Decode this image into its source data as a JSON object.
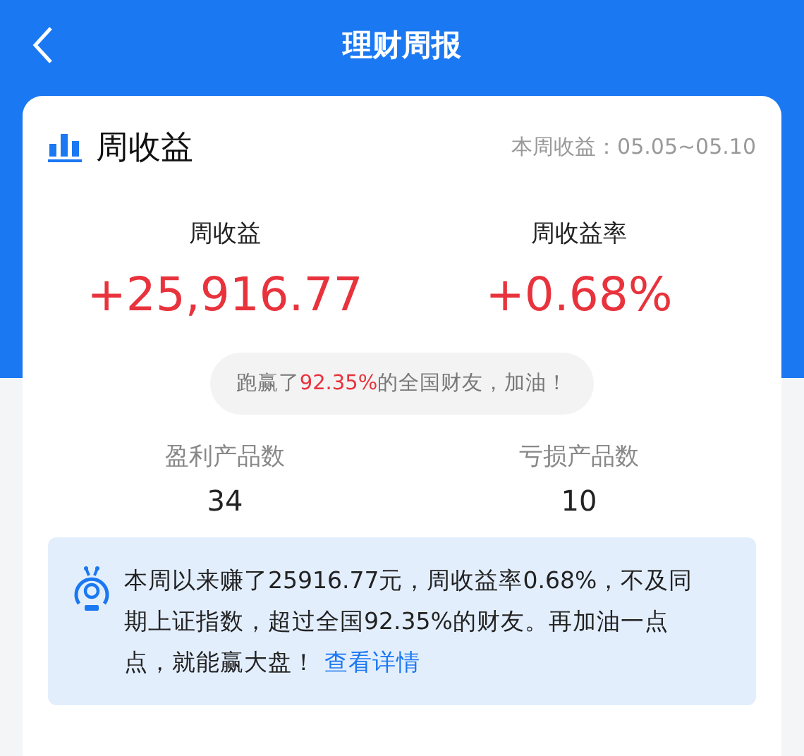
{
  "nav": {
    "title": "理财周报"
  },
  "card": {
    "title": "周收益",
    "period_label": "本周收益：",
    "period": "05.05~05.10",
    "stats": [
      {
        "label": "周收益",
        "value": "+25,916.77"
      },
      {
        "label": "周收益率",
        "value": "+0.68%"
      }
    ],
    "rank": {
      "before": "跑赢了",
      "highlight": "92.35%",
      "after": "的全国财友，加油！"
    },
    "counts": [
      {
        "label": "盈利产品数",
        "value": "34"
      },
      {
        "label": "亏损产品数",
        "value": "10"
      }
    ],
    "summary": {
      "text": "本周以来赚了25916.77元，周收益率0.68%，不及同期上证指数，超过全国92.35%的财友。再加油一点点，就能赢大盘！",
      "link": "查看详情"
    }
  }
}
